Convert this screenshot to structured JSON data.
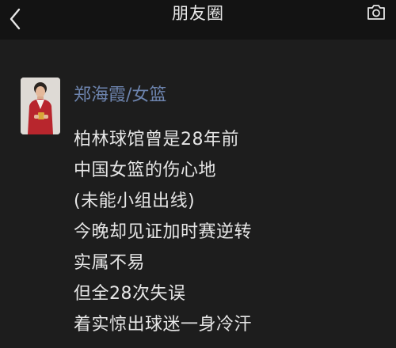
{
  "nav": {
    "title": "朋友圈",
    "back_icon": "chevron-left-icon",
    "camera_icon": "camera-icon"
  },
  "post": {
    "author": "郑海霞/女篮",
    "lines": [
      "柏林球馆曾是28年前",
      "中国女篮的伤心地",
      "(未能小组出线)",
      "今晚却见证加时赛逆转",
      "实属不易",
      "但全28次失误",
      "着实惊出球迷一身冷汗"
    ]
  },
  "colors": {
    "background": "#1b1b1b",
    "nav_background": "#131313",
    "author_link": "#6d84ae",
    "text": "#e6e6e6"
  }
}
